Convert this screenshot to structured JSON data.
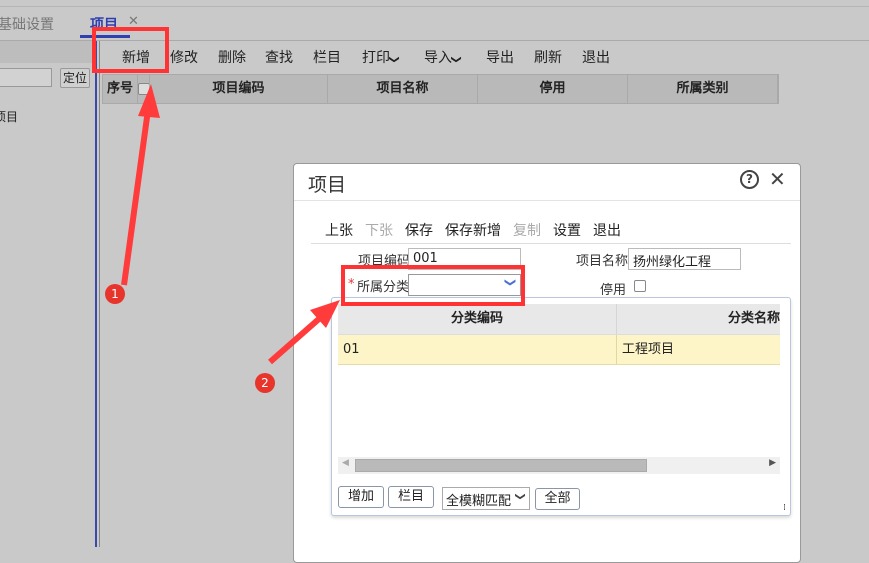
{
  "tabs": {
    "inactive": "基础设置",
    "active": "项目"
  },
  "sidebar": {
    "locate_button": "定位",
    "tree_item": "项目"
  },
  "toolbar": [
    "新增",
    "修改",
    "删除",
    "查找",
    "栏目",
    "打印",
    "导入",
    "导出",
    "刷新",
    "退出"
  ],
  "grid": {
    "columns": [
      "序号",
      "",
      "项目编码",
      "项目名称",
      "停用",
      "所属类别"
    ]
  },
  "dialog": {
    "title": "项目",
    "toolbar": [
      {
        "label": "上张",
        "enabled": true
      },
      {
        "label": "下张",
        "enabled": false
      },
      {
        "label": "保存",
        "enabled": true
      },
      {
        "label": "保存新增",
        "enabled": true
      },
      {
        "label": "复制",
        "enabled": false
      },
      {
        "label": "设置",
        "enabled": true
      },
      {
        "label": "退出",
        "enabled": true
      }
    ],
    "fields": {
      "code_label": "项目编码",
      "code_value": "001",
      "name_label": "项目名称",
      "name_value": "扬州绿化工程",
      "category_label": "所属分类",
      "category_required": "*",
      "category_value": "",
      "disabled_label": "停用"
    },
    "dropdown": {
      "columns": [
        "分类编码",
        "分类名称"
      ],
      "rows": [
        [
          "01",
          "工程项目"
        ]
      ],
      "buttons": {
        "add": "增加",
        "columns": "栏目",
        "all": "全部"
      },
      "match_mode": "全模糊匹配"
    }
  },
  "annotations": {
    "step1": "1",
    "step2": "2",
    "color": "#ff3333"
  }
}
